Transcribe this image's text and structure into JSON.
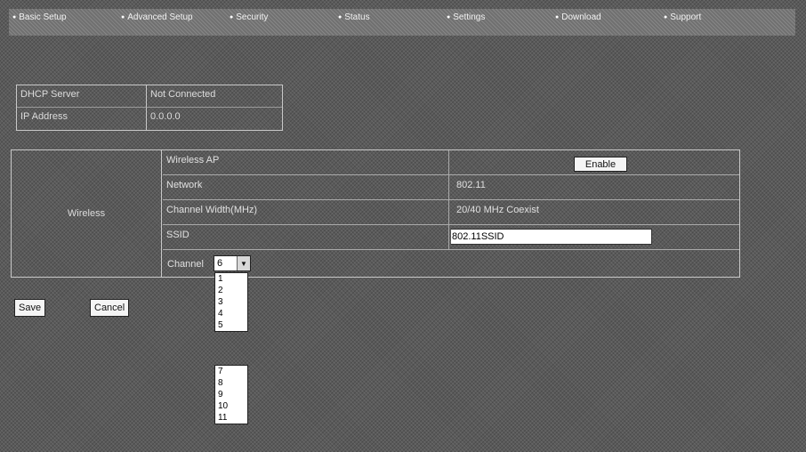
{
  "nav": {
    "items": [
      {
        "label": "Basic Setup"
      },
      {
        "label": "Advanced Setup"
      },
      {
        "label": "Security"
      },
      {
        "label": "Status"
      },
      {
        "label": "Settings"
      },
      {
        "label": "Download"
      },
      {
        "label": "Support"
      }
    ]
  },
  "status": {
    "row1_label": "DHCP Server",
    "row1_value": "Not Connected",
    "row2_label": "IP Address",
    "row2_value": "0.0.0.0"
  },
  "wireless": {
    "section_label": "Wireless",
    "row1_label": "Wireless AP",
    "enable_label": "Enable",
    "row2_label": "Network",
    "row2_value": "802.11",
    "row3_label": "Channel Width(MHz)",
    "row3_value": "20/40 MHz Coexist",
    "row4_label": "SSID",
    "ssid_value": "802.11SSID",
    "channel_label": "Channel",
    "channel_selected": "6",
    "channel_options_top": [
      "1",
      "2",
      "3",
      "4",
      "5"
    ],
    "channel_options_bottom": [
      "7",
      "8",
      "9",
      "10",
      "11"
    ]
  },
  "actions": {
    "save_label": "Save",
    "cancel_label": "Cancel"
  },
  "colors": {
    "background": "#5a5a5a",
    "text": "#e8e8e8",
    "input_bg": "#ffffff"
  }
}
